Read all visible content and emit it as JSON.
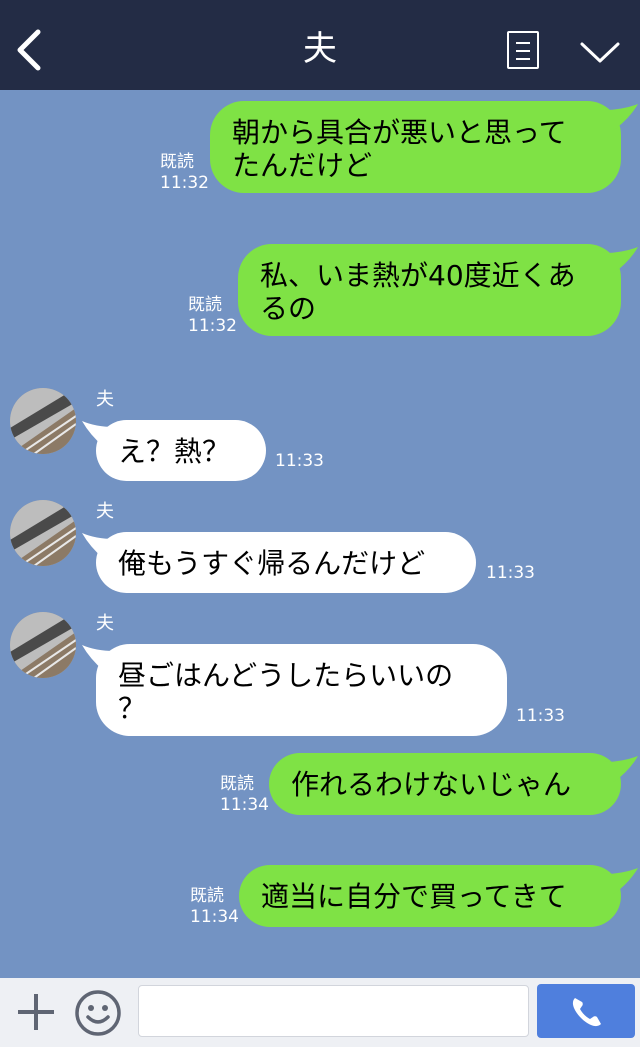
{
  "header": {
    "title": "夫",
    "back_icon": "chevron-left-icon",
    "memo_icon": "note-icon",
    "collapse_icon": "chevron-down-icon"
  },
  "colors": {
    "header_bg": "#232c45",
    "chat_bg": "#7393c3",
    "outgoing_bubble": "#7fe245",
    "incoming_bubble": "#ffffff",
    "call_button": "#4f7fdd"
  },
  "messages": [
    {
      "direction": "out",
      "text_line1": "朝から具合が悪いと思って",
      "text_line2": "たんだけど",
      "read": "既読",
      "time": "11:32"
    },
    {
      "direction": "out",
      "text_line1": "私、いま熱が40度近くあ",
      "text_line2": "るの",
      "read": "既読",
      "time": "11:32"
    },
    {
      "direction": "in",
      "sender": "夫",
      "text_line1": "え？熱？",
      "time": "11:33"
    },
    {
      "direction": "in",
      "sender": "夫",
      "text_line1": "俺もうすぐ帰るんだけど",
      "time": "11:33"
    },
    {
      "direction": "in",
      "sender": "夫",
      "text_line1": "昼ごはんどうしたらいいの",
      "text_line2": "？",
      "time": "11:33"
    },
    {
      "direction": "out",
      "text_line1": "作れるわけないじゃん",
      "read": "既読",
      "time": "11:34"
    },
    {
      "direction": "out",
      "text_line1": "適当に自分で買ってきて",
      "read": "既読",
      "time": "11:34"
    }
  ],
  "footer": {
    "plus_icon": "plus-icon",
    "emoji_icon": "smiley-icon",
    "input_value": "",
    "call_icon": "phone-icon"
  }
}
